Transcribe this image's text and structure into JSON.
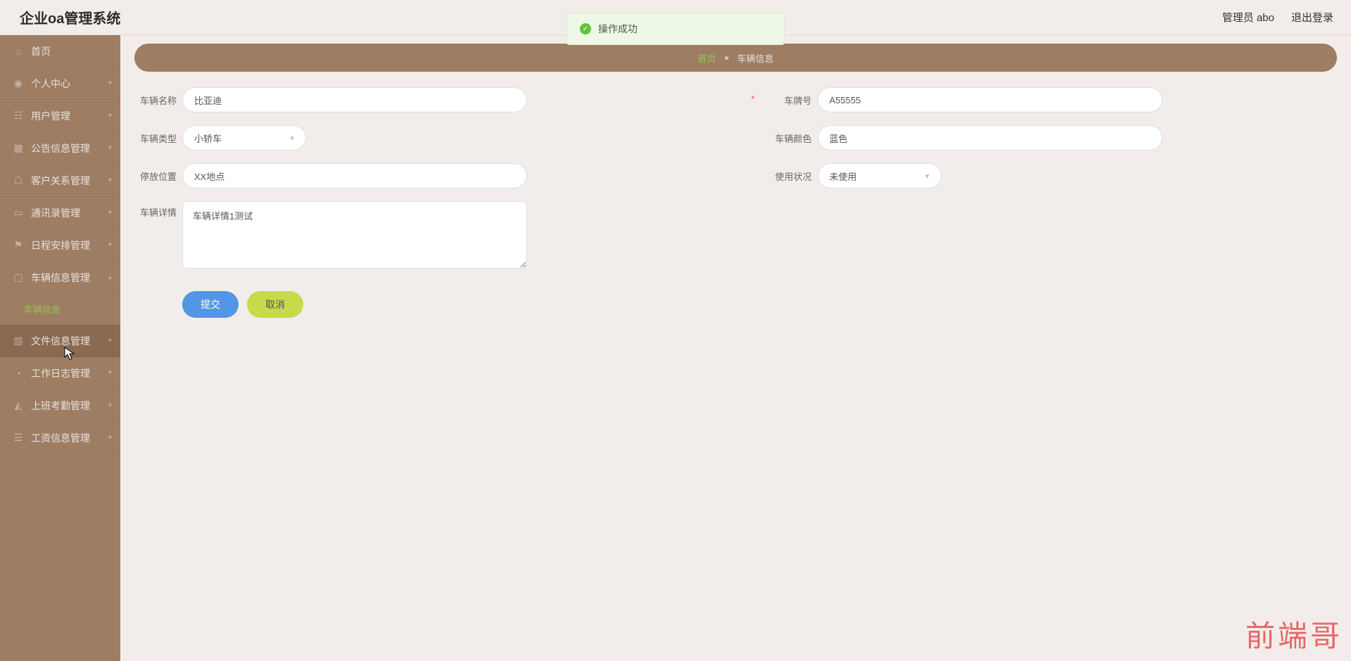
{
  "app": {
    "title": "企业oa管理系统"
  },
  "topRight": {
    "adminLabel": "管理员 abo",
    "logoutLabel": "退出登录"
  },
  "toast": {
    "text": "操作成功"
  },
  "sidebar": {
    "items": [
      {
        "label": "首页"
      },
      {
        "label": "个人中心"
      },
      {
        "label": "用户管理"
      },
      {
        "label": "公告信息管理"
      },
      {
        "label": "客户关系管理"
      },
      {
        "label": "通讯录管理"
      },
      {
        "label": "日程安排管理"
      },
      {
        "label": "车辆信息管理",
        "expanded": true
      },
      {
        "label": "文件信息管理"
      },
      {
        "label": "工作日志管理"
      },
      {
        "label": "上班考勤管理"
      },
      {
        "label": "工资信息管理"
      }
    ],
    "subItem": "车辆信息"
  },
  "breadcrumb": {
    "home": "首页",
    "current": "车辆信息"
  },
  "form": {
    "name": {
      "label": "车辆名称",
      "value": "比亚迪"
    },
    "plate": {
      "label": "车牌号",
      "value": "A55555"
    },
    "type": {
      "label": "车辆类型",
      "value": "小轿车"
    },
    "color": {
      "label": "车辆颜色",
      "value": "蓝色"
    },
    "location": {
      "label": "停放位置",
      "value": "XX地点"
    },
    "status": {
      "label": "使用状况",
      "value": "未使用"
    },
    "detail": {
      "label": "车辆详情",
      "value": "车辆详情1测试"
    }
  },
  "buttons": {
    "submit": "提交",
    "cancel": "取消"
  },
  "watermark": "前端哥"
}
